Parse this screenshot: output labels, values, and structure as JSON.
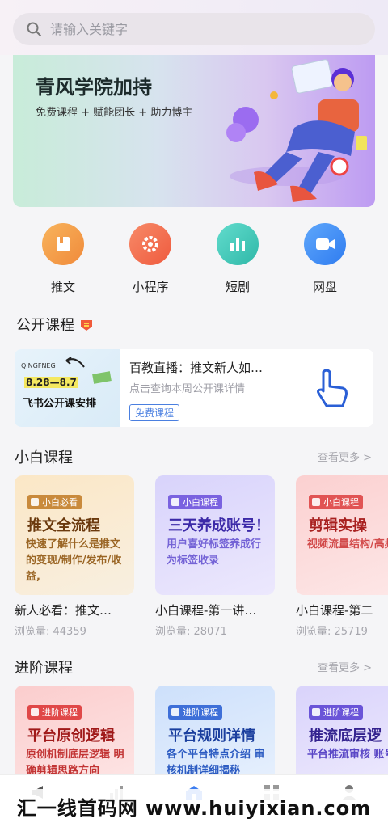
{
  "search": {
    "placeholder": "请输入关键字"
  },
  "banner": {
    "title": "青风学院加持",
    "subtitle": "免费课程 + 赋能团长 + 助力博主"
  },
  "quick": [
    {
      "label": "推文",
      "icon": "book-icon",
      "color": "#f39a48"
    },
    {
      "label": "小程序",
      "icon": "gear-icon",
      "color": "#f26c4f"
    },
    {
      "label": "短剧",
      "icon": "bar-chart-icon",
      "color": "#3fc9b9"
    },
    {
      "label": "网盘",
      "icon": "video-icon",
      "color": "#3d8ef5"
    }
  ],
  "public": {
    "title": "公开课程",
    "card": {
      "title": "百教直播：推文新人如…",
      "subtitle": "点击查询本周公开课详情",
      "tag": "免费课程",
      "thumb_text": "飞书公开课安排",
      "thumb_date": "8.28—8.7",
      "thumb_brand": "QINGFNEG"
    }
  },
  "beginner": {
    "title": "小白课程",
    "more": "查看更多 >",
    "cards": [
      {
        "badge": "小白必看",
        "heading": "推文全流程",
        "desc": "快速了解什么是推文的变现/制作/发布/收益,",
        "title": "新人必看：推文…",
        "views": "浏览量: 44359"
      },
      {
        "badge": "小白课程",
        "heading": "三天养成账号！",
        "desc": "用户喜好标签养成行为标签收录",
        "title": "小白课程-第一讲…",
        "views": "浏览量: 28071"
      },
      {
        "badge": "小白课程",
        "heading": "剪辑实操",
        "desc": "视频流量结构/高频来源/高精细",
        "title": "小白课程-第二",
        "views": "浏览量: 25719"
      }
    ]
  },
  "advanced": {
    "title": "进阶课程",
    "more": "查看更多 >",
    "cards": [
      {
        "badge": "进阶课程",
        "heading": "平台原创逻辑",
        "desc": "原创机制底层逻辑 明确剪辑思路方向"
      },
      {
        "badge": "进阶课程",
        "heading": "平台规则详情",
        "desc": "各个平台特点介绍 审核机制详细揭秘"
      },
      {
        "badge": "进阶课程",
        "heading": "推流底层逻",
        "desc": "平台推流审核 账号推流运营"
      }
    ]
  },
  "watermark": "汇一线首码网 www.huiyixian.com"
}
